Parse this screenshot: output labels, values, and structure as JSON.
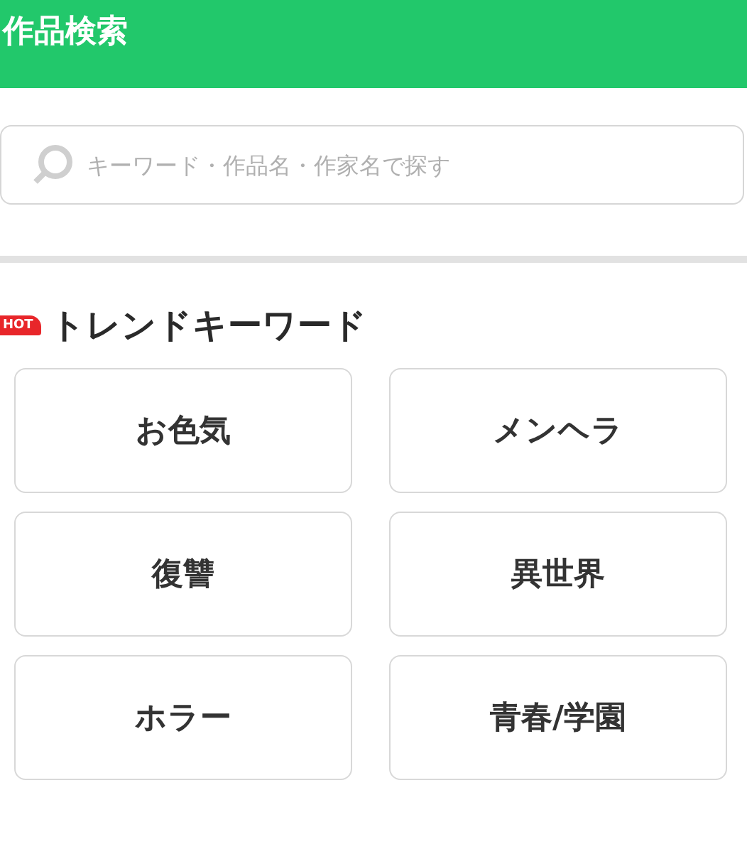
{
  "header": {
    "title": "作品検索"
  },
  "search": {
    "placeholder": "キーワード・作品名・作家名で探す"
  },
  "trend": {
    "badge": "HOT",
    "title": "トレンドキーワード",
    "keywords": [
      "お色気",
      "メンヘラ",
      "復讐",
      "異世界",
      "ホラー",
      "青春/学園"
    ]
  }
}
